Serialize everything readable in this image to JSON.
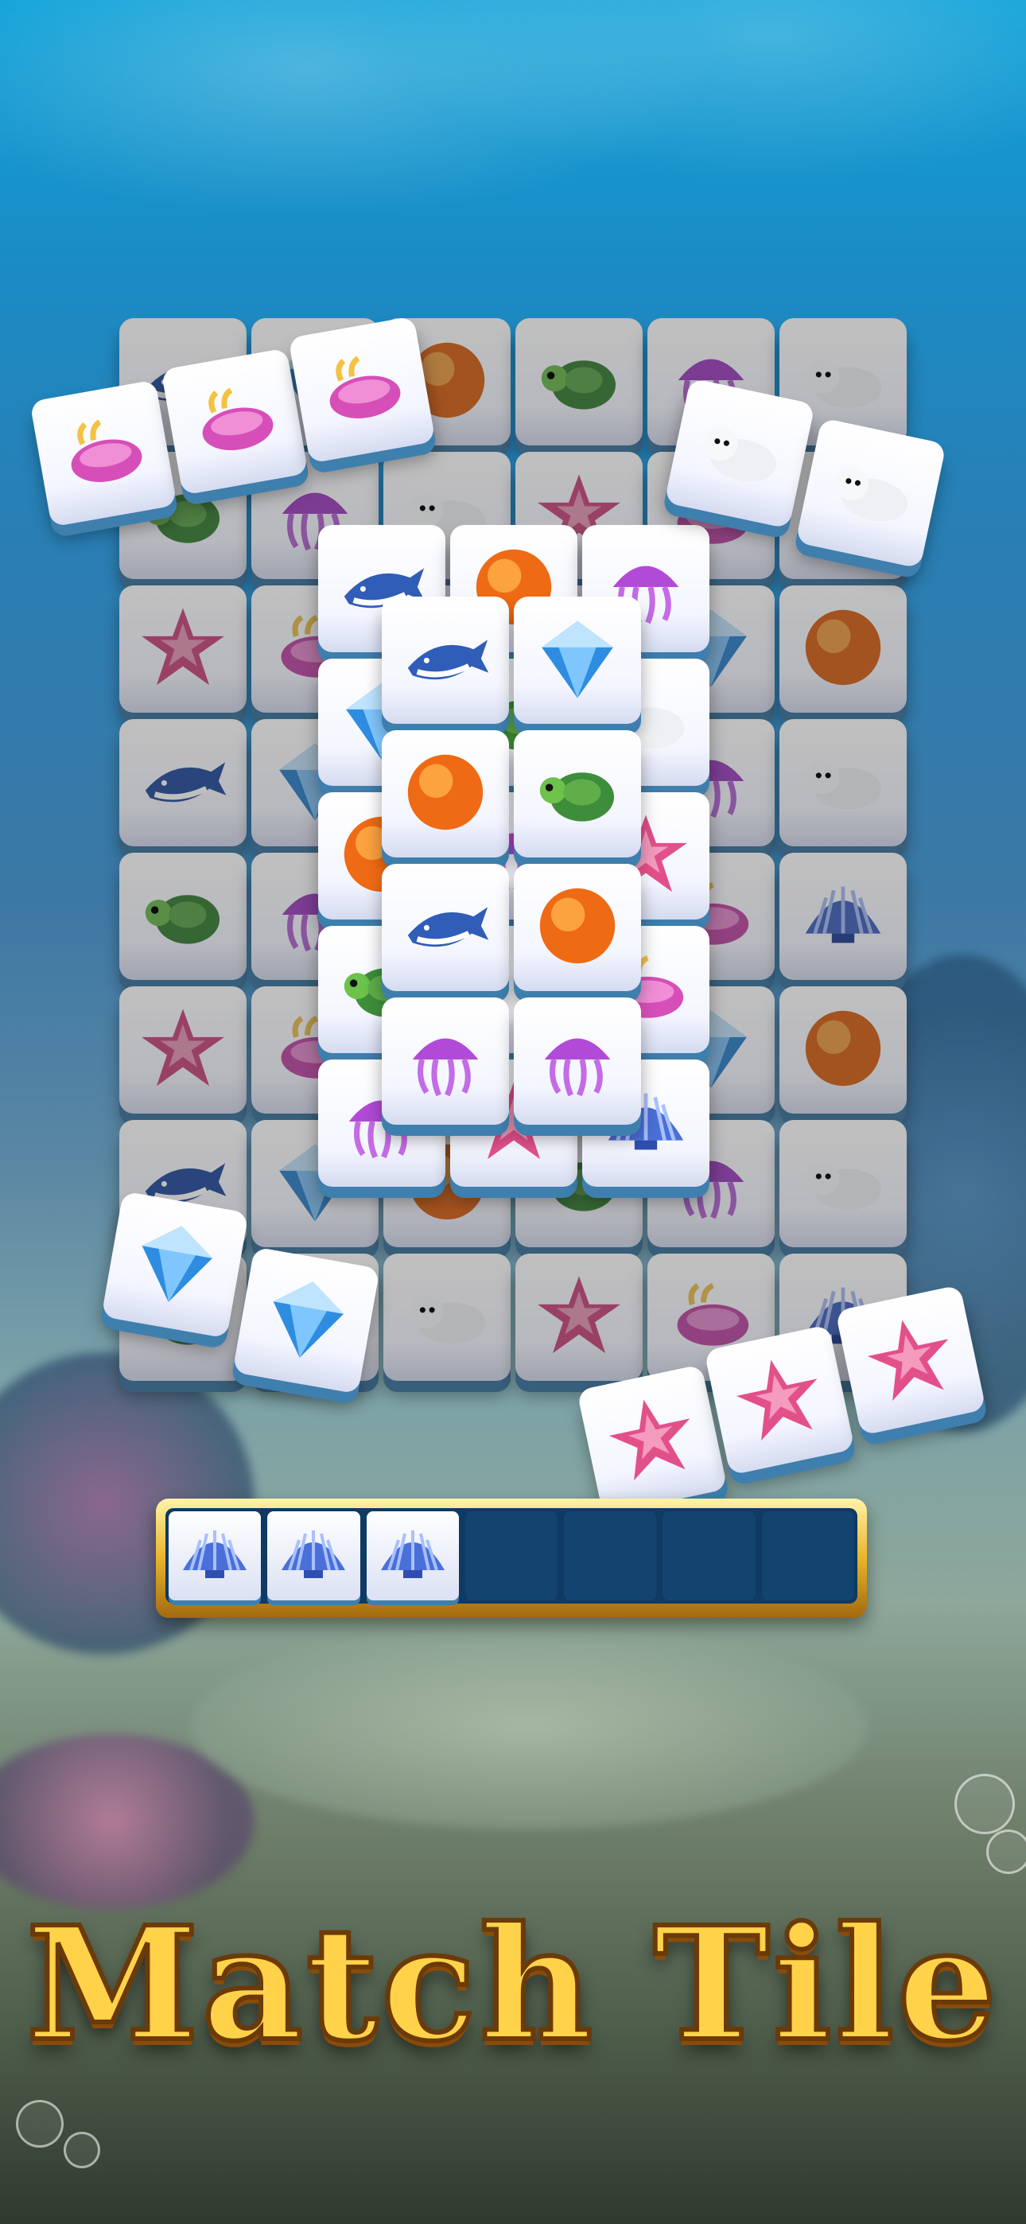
{
  "title": "Match Tile",
  "tray": {
    "slot_count": 7,
    "filled": [
      "shell-icon",
      "shell-icon",
      "shell-icon"
    ]
  },
  "colors": {
    "title_gold": "#ffd24a",
    "tray_gold": "#e9b42a",
    "tray_bg": "#0e3a64"
  },
  "board": {
    "tile_icons": [
      "shark-icon",
      "diamond-icon",
      "orange-ball-icon",
      "turtle-icon",
      "jellyfish-icon",
      "seal-icon",
      "starfish-icon",
      "seaslug-icon",
      "shell-icon"
    ]
  }
}
